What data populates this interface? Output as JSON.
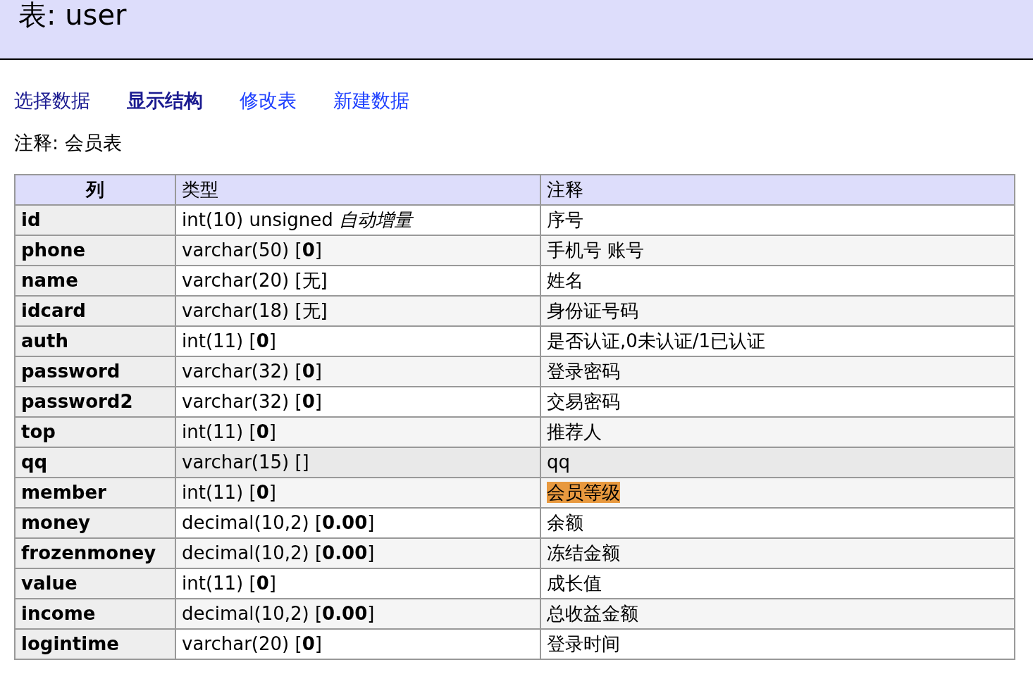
{
  "title": "表: user",
  "links": [
    {
      "label": "选择数据",
      "selected": false,
      "visited": true
    },
    {
      "label": "显示结构",
      "selected": true,
      "visited": true
    },
    {
      "label": "修改表",
      "selected": false,
      "visited": false
    },
    {
      "label": "新建数据",
      "selected": false,
      "visited": false
    }
  ],
  "comment": "注释: 会员表",
  "table": {
    "columns": [
      "列",
      "类型",
      "注释"
    ],
    "rows": [
      {
        "name": "id",
        "type": "int(10) unsigned *自动增量*",
        "comment": "序号",
        "hovered": false,
        "comment_highlighted": false
      },
      {
        "name": "phone",
        "type": "varchar(50) [**0**]",
        "comment": "手机号 账号",
        "hovered": false,
        "comment_highlighted": false
      },
      {
        "name": "name",
        "type": "varchar(20) [无]",
        "comment": "姓名",
        "hovered": false,
        "comment_highlighted": false
      },
      {
        "name": "idcard",
        "type": "varchar(18) [无]",
        "comment": "身份证号码",
        "hovered": false,
        "comment_highlighted": false
      },
      {
        "name": "auth",
        "type": "int(11) [**0**]",
        "comment": "是否认证,0未认证/1已认证",
        "hovered": false,
        "comment_highlighted": false
      },
      {
        "name": "password",
        "type": "varchar(32) [**0**]",
        "comment": "登录密码",
        "hovered": false,
        "comment_highlighted": false
      },
      {
        "name": "password2",
        "type": "varchar(32) [**0**]",
        "comment": "交易密码",
        "hovered": false,
        "comment_highlighted": false
      },
      {
        "name": "top",
        "type": "int(11) [**0**]",
        "comment": "推荐人",
        "hovered": false,
        "comment_highlighted": false
      },
      {
        "name": "qq",
        "type": "varchar(15) []",
        "comment": "qq",
        "hovered": true,
        "comment_highlighted": false
      },
      {
        "name": "member",
        "type": "int(11) [**0**]",
        "comment": "会员等级",
        "hovered": false,
        "comment_highlighted": true
      },
      {
        "name": "money",
        "type": "decimal(10,2) [**0.00**]",
        "comment": "余额",
        "hovered": false,
        "comment_highlighted": false
      },
      {
        "name": "frozenmoney",
        "type": "decimal(10,2) [**0.00**]",
        "comment": "冻结金额",
        "hovered": false,
        "comment_highlighted": false
      },
      {
        "name": "value",
        "type": "int(11) [**0**]",
        "comment": "成长值",
        "hovered": false,
        "comment_highlighted": false
      },
      {
        "name": "income",
        "type": "decimal(10,2) [**0.00**]",
        "comment": "总收益金额",
        "hovered": false,
        "comment_highlighted": false
      },
      {
        "name": "logintime",
        "type": "varchar(20) [**0**]",
        "comment": "登录时间",
        "hovered": false,
        "comment_highlighted": false
      }
    ]
  }
}
